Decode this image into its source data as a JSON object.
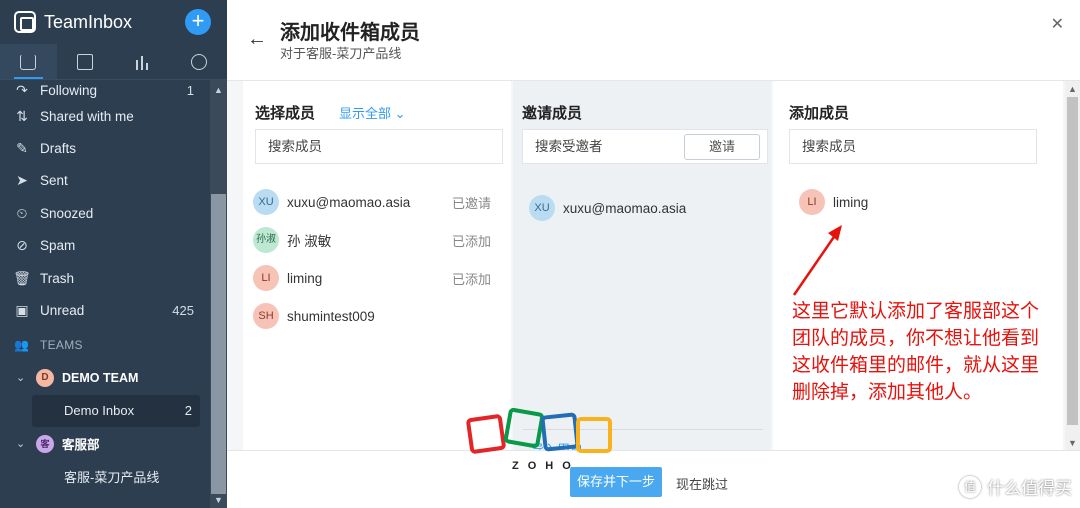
{
  "app": {
    "name": "TeamInbox",
    "compose_icon": "plus-icon"
  },
  "colors": {
    "sidebar_bg": "#2c3e50",
    "accent": "#2f9bf4",
    "primary_button": "#4aa8f0",
    "annotation": "#e8120c"
  },
  "sidebar": {
    "top_tabs": [
      {
        "icon": "inbox-icon",
        "active": true
      },
      {
        "icon": "contacts-icon",
        "active": false
      },
      {
        "icon": "reports-icon",
        "active": false
      },
      {
        "icon": "activity-icon",
        "active": false
      }
    ],
    "items": [
      {
        "label": "Following",
        "count": "1",
        "icon": "following-icon"
      },
      {
        "label": "Shared with me",
        "count": "",
        "icon": "shared-icon"
      },
      {
        "label": "Drafts",
        "count": "",
        "icon": "drafts-icon"
      },
      {
        "label": "Sent",
        "count": "",
        "icon": "sent-icon"
      },
      {
        "label": "Snoozed",
        "count": "",
        "icon": "snooze-icon"
      },
      {
        "label": "Spam",
        "count": "",
        "icon": "spam-icon"
      },
      {
        "label": "Trash",
        "count": "",
        "icon": "trash-icon"
      },
      {
        "label": "Unread",
        "count": "425",
        "icon": "unread-icon"
      }
    ],
    "teams_label": "TEAMS",
    "teams": [
      {
        "name": "DEMO TEAM",
        "avatar": "D",
        "avatar_color": "#f7b7a3",
        "inboxes": [
          {
            "label": "Demo Inbox",
            "count": "2",
            "active": true
          }
        ]
      },
      {
        "name": "客服部",
        "avatar": "客",
        "avatar_color": "#c9a7e8",
        "inboxes": [
          {
            "label": "客服-菜刀产品线",
            "count": "",
            "active": false
          }
        ]
      }
    ]
  },
  "modal": {
    "title": "添加收件箱成员",
    "subtitle": "对于客服-菜刀产品线",
    "select_column": {
      "title": "选择成员",
      "show_all": "显示全部",
      "search_placeholder": "搜索成员",
      "members": [
        {
          "avatar": "XU",
          "avatar_color": "#b9dcf2",
          "name": "xuxu@maomao.asia",
          "status": "已邀请"
        },
        {
          "avatar": "孙淑",
          "avatar_color": "#bfe8d3",
          "name": "孙 淑敏",
          "status": "已添加"
        },
        {
          "avatar": "LI",
          "avatar_color": "#f7c3b6",
          "name": "liming",
          "status": "已添加"
        },
        {
          "avatar": "SH",
          "avatar_color": "#f7c3b6",
          "name": "shumintest009",
          "status": ""
        }
      ]
    },
    "invite_column": {
      "title": "邀请成员",
      "search_placeholder": "搜索受邀者",
      "invite_button": "邀请",
      "members": [
        {
          "avatar": "XU",
          "avatar_color": "#b9dcf2",
          "name": "xuxu@maomao.asia"
        }
      ],
      "import_link": "导入用户"
    },
    "add_column": {
      "title": "添加成员",
      "search_placeholder": "搜索成员",
      "members": [
        {
          "avatar": "LI",
          "avatar_color": "#f7c3b6",
          "name": "liming"
        }
      ]
    },
    "footer": {
      "primary": "保存并下一步",
      "skip": "现在跳过"
    }
  },
  "annotation": {
    "text": "这里它默认添加了客服部这个团队的成员，你不想让他看到这收件箱里的邮件，就从这里删除掉，添加其他人。"
  },
  "watermarks": {
    "zoho": "ZOHO",
    "site": "什么值得买",
    "site_badge": "值"
  }
}
